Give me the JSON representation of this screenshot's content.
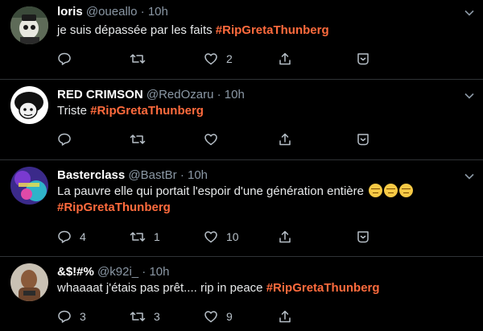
{
  "tweets": [
    {
      "name": "loris",
      "handle": "@oueallo",
      "sep": "·",
      "time": "10h",
      "text": "je suis dépassée par les faits ",
      "text2": "",
      "hashtag": "#RipGretaThunberg",
      "replies": "",
      "retweets": "",
      "likes": "2",
      "emoji_count": 0
    },
    {
      "name": "RED CRIMSON",
      "handle": "@RedOzaru",
      "sep": "·",
      "time": "10h",
      "text": "Triste ",
      "text2": "",
      "hashtag": "#RipGretaThunberg",
      "replies": "",
      "retweets": "",
      "likes": "",
      "emoji_count": 0
    },
    {
      "name": "Basterclass",
      "handle": "@BastBr",
      "sep": "·",
      "time": "10h",
      "text": "La pauvre elle qui portait l'espoir d'une génération entière",
      "text2": "",
      "hashtag": "#RipGretaThunberg",
      "replies": "4",
      "retweets": "1",
      "likes": "10",
      "emoji_count": 3
    },
    {
      "name": "&$!#%",
      "handle": "@k92i_",
      "sep": "·",
      "time": "10h",
      "text": "whaaaat j'étais pas prêt.... rip in peace ",
      "text2": "",
      "hashtag": "#RipGretaThunberg",
      "replies": "3",
      "retweets": "3",
      "likes": "9",
      "emoji_count": 0
    }
  ],
  "icons": [
    "reply-icon",
    "retweet-icon",
    "like-icon",
    "share-icon",
    "save-icon",
    "chevron-down-icon"
  ],
  "colors": {
    "background": "#000000",
    "hashtag": "#ff6b3d",
    "muted": "#8b98a5",
    "divider": "#2f3336"
  }
}
